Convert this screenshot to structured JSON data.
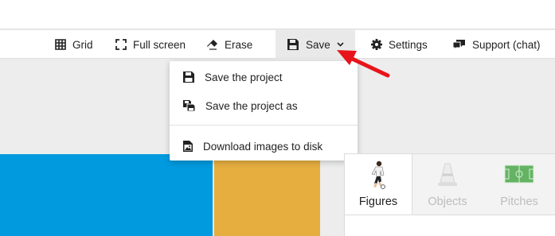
{
  "toolbar": {
    "grid_label": "Grid",
    "fullscreen_label": "Full screen",
    "erase_label": "Erase",
    "save_label": "Save",
    "settings_label": "Settings",
    "support_label": "Support (chat)"
  },
  "save_menu": {
    "items": [
      {
        "label": "Save the project",
        "icon": "floppy-disk-icon"
      },
      {
        "label": "Save the project as",
        "icon": "floppy-disks-icon"
      },
      {
        "label": "Download images to disk",
        "icon": "image-file-icon"
      }
    ]
  },
  "library": {
    "tabs": [
      {
        "label": "Figures",
        "icon": "player-figure-icon",
        "active": true
      },
      {
        "label": "Objects",
        "icon": "cone-icon",
        "active": false
      },
      {
        "label": "Pitches",
        "icon": "pitch-icon",
        "active": false
      }
    ]
  },
  "colors": {
    "panel_blue": "#019ade",
    "panel_gold": "#e5ae3f",
    "annotation_arrow": "#e8141b",
    "pitch_green": "#3fa33f"
  }
}
